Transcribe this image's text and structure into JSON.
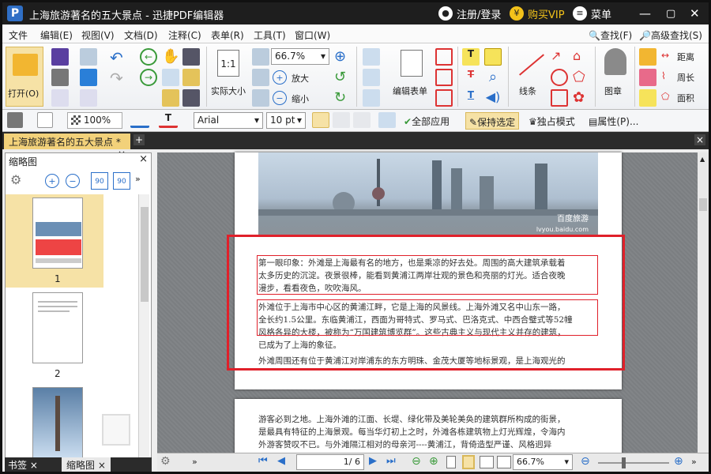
{
  "titlebar": {
    "title": "上海旅游著名的五大景点 - 迅捷PDF编辑器",
    "register_login": "注册/登录",
    "buy_vip": "购买VIP",
    "menu": "菜单"
  },
  "menu": {
    "items": [
      "文件",
      "编辑(E)",
      "视图(V)",
      "文档(D)",
      "注释(C)",
      "表单(R)",
      "工具(T)",
      "窗口(W)"
    ],
    "find": "查找(F)",
    "advanced_find": "高级查找(S)"
  },
  "ribbon": {
    "open": "打开(O)",
    "actual_size": "实际大小",
    "zoom_value": "66.7%",
    "zoom_in": "放大",
    "zoom_out": "缩小",
    "edit_form": "编辑表单",
    "line": "线条",
    "stamp": "图章",
    "distance": "距离",
    "perimeter": "周长",
    "area": "面积"
  },
  "format": {
    "zoom": "100%",
    "font": "Arial",
    "size": "10 pt",
    "apply_all": "全部应用",
    "keep_selected": "保持选定",
    "exclusive_mode": "独占模式",
    "properties": "属性(P)..."
  },
  "tab": {
    "label": "上海旅游著名的五大景点 *"
  },
  "sidebar": {
    "title": "缩略图",
    "thumbs": [
      "1",
      "2"
    ],
    "tab_bookmarks": "书签",
    "tab_thumbnails": "缩略图"
  },
  "document": {
    "para1": [
      "第一眼印象：外滩是上海最有名的地方，也是乘凉的好去处。周围的高大建筑承载着",
      "太多历史的沉淀。夜景很棒，能看到黄浦江两岸壮观的景色和亮丽的灯光。适合夜晚",
      "漫步，看看夜色，吹吹海风。"
    ],
    "para2": [
      "外滩位于上海市中心区的黄浦江畔，它是上海的风景线。上海外滩又名中山东一路，",
      "全长约1.5公里。东临黄浦江，西面为哥特式、罗马式、巴洛克式、中西合璧式等52幢",
      "风格各异的大楼，被称为“万国建筑博览群”。这些古典主义与现代主义并存的建筑，",
      "已成为了上海的象征。"
    ],
    "para3": "外滩周围还有位于黄浦江对岸浦东的东方明珠、金茂大厦等地标景观，是上海观光的",
    "page2": [
      "游客必到之地。上海外滩的江面、长堤、绿化带及美轮美奂的建筑群所构成的街景，",
      "是最具有特征的上海景观。每当华灯初上之时，外滩各栋建筑物上灯光辉煌，令海内",
      "外游客赞叹不已。与外滩隔江相对的母亲河----黄浦江，背倚造型严谨、风格迥异"
    ],
    "watermark": "百度旅游",
    "watermark_url": "lvyou.baidu.com"
  },
  "status": {
    "page_input": "1",
    "page_total": "/ 6",
    "zoom": "66.7%"
  },
  "colors": {
    "accent_red": "#e0202a",
    "tab_active": "#f2d17a",
    "titlebar": "#1e1e1e"
  }
}
